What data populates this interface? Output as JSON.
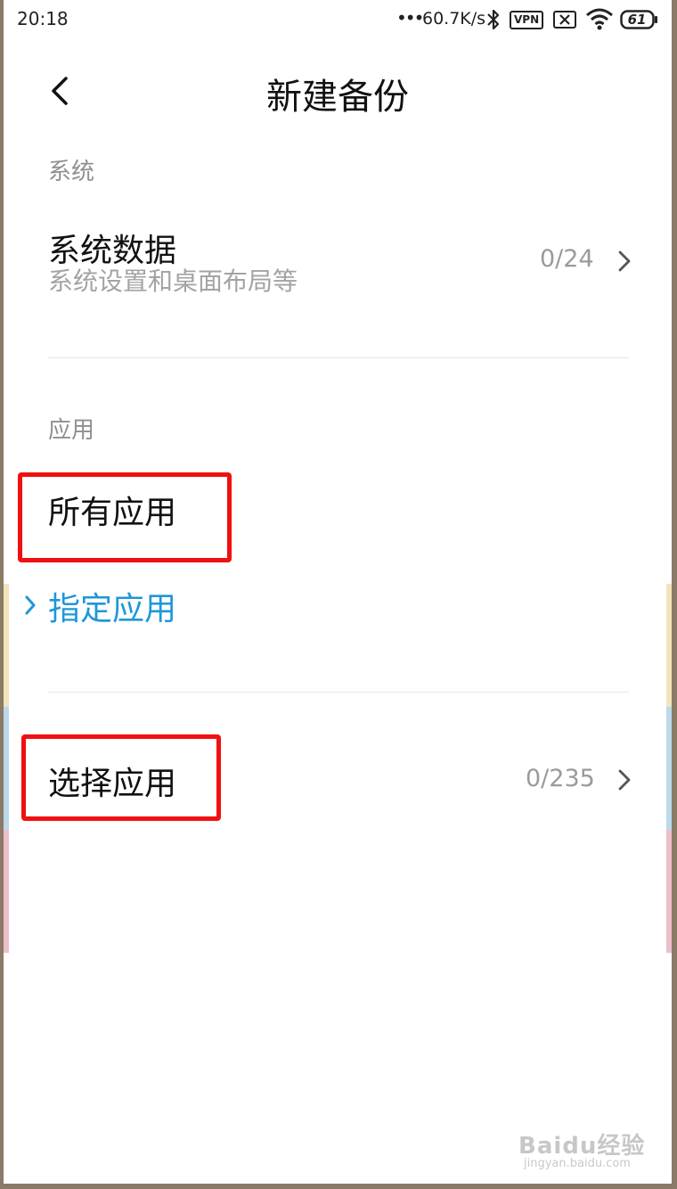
{
  "status_bar": {
    "time": "20:18",
    "signal_dots": "•••",
    "network_speed": "60.7K/s",
    "vpn_label": "VPN",
    "battery_level": "61"
  },
  "header": {
    "back_icon": "chevron-left-icon",
    "title": "新建备份"
  },
  "sections": {
    "system": {
      "label": "系统",
      "item": {
        "title": "系统数据",
        "subtitle": "系统设置和桌面布局等",
        "count": "0/24"
      }
    },
    "apps": {
      "label": "应用",
      "options": [
        {
          "label": "所有应用",
          "selected": false
        },
        {
          "label": "指定应用",
          "selected": true
        }
      ],
      "select_item": {
        "title": "选择应用",
        "count": "0/235"
      }
    }
  },
  "watermark": {
    "brand": "Baidu经验",
    "url": "jingyan.baidu.com"
  },
  "colors": {
    "accent": "#1f97d8",
    "highlight_red": "#f01010"
  }
}
